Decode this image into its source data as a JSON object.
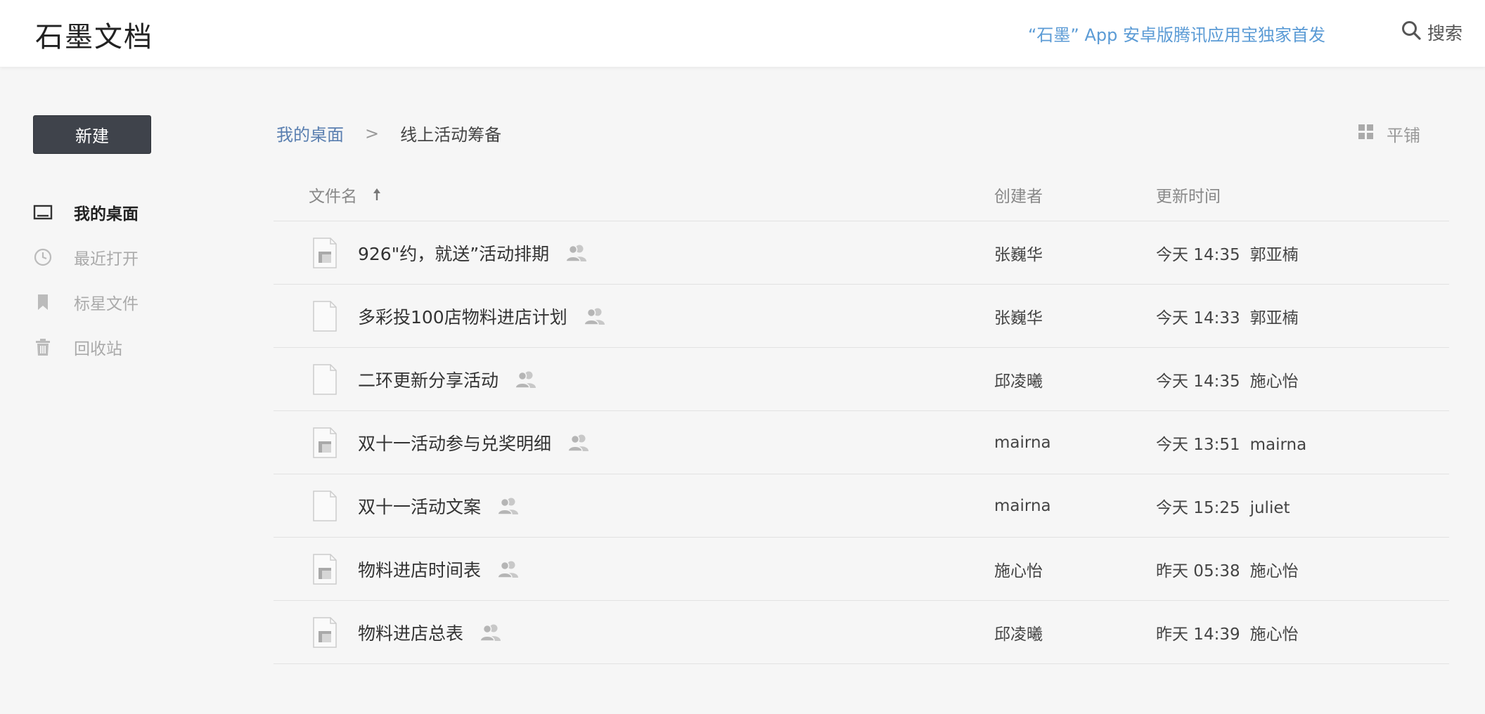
{
  "header": {
    "logo": "石墨文档",
    "promo": "“石墨” App 安卓版腾讯应用宝独家首发",
    "search_label": "搜索"
  },
  "sidebar": {
    "new_button": "新建",
    "items": [
      {
        "label": "我的桌面",
        "icon": "desktop-icon",
        "active": true
      },
      {
        "label": "最近打开",
        "icon": "clock-icon",
        "active": false
      },
      {
        "label": "标星文件",
        "icon": "bookmark-icon",
        "active": false
      },
      {
        "label": "回收站",
        "icon": "trash-icon",
        "active": false
      }
    ]
  },
  "breadcrumb": {
    "root": "我的桌面",
    "separator": ">",
    "current": "线上活动筹备"
  },
  "view_toggle": {
    "label": "平铺",
    "icon": "grid-icon"
  },
  "table": {
    "headers": {
      "name": "文件名",
      "creator": "创建者",
      "updated": "更新时间"
    },
    "rows": [
      {
        "name": "926\"约，就送”活动排期",
        "type": "sheet",
        "creator": "张巍华",
        "time": "今天 14:35",
        "editor": "郭亚楠"
      },
      {
        "name": "多彩投100店物料进店计划",
        "type": "doc",
        "creator": "张巍华",
        "time": "今天 14:33",
        "editor": "郭亚楠"
      },
      {
        "name": "二环更新分享活动",
        "type": "doc",
        "creator": "邱凌曦",
        "time": "今天 14:35",
        "editor": "施心怡"
      },
      {
        "name": "双十一活动参与兑奖明细",
        "type": "sheet",
        "creator": "mairna",
        "time": "今天 13:51",
        "editor": "mairna"
      },
      {
        "name": "双十一活动文案",
        "type": "doc",
        "creator": "mairna",
        "time": "今天 15:25",
        "editor": "juliet"
      },
      {
        "name": "物料进店时间表",
        "type": "sheet",
        "creator": "施心怡",
        "time": "昨天 05:38",
        "editor": "施心怡"
      },
      {
        "name": "物料进店总表",
        "type": "sheet",
        "creator": "邱凌曦",
        "time": "昨天 14:39",
        "editor": "施心怡"
      }
    ]
  },
  "colors": {
    "accent": "#5a7fb0",
    "promo": "#5b9bd5",
    "button": "#3f434b"
  }
}
